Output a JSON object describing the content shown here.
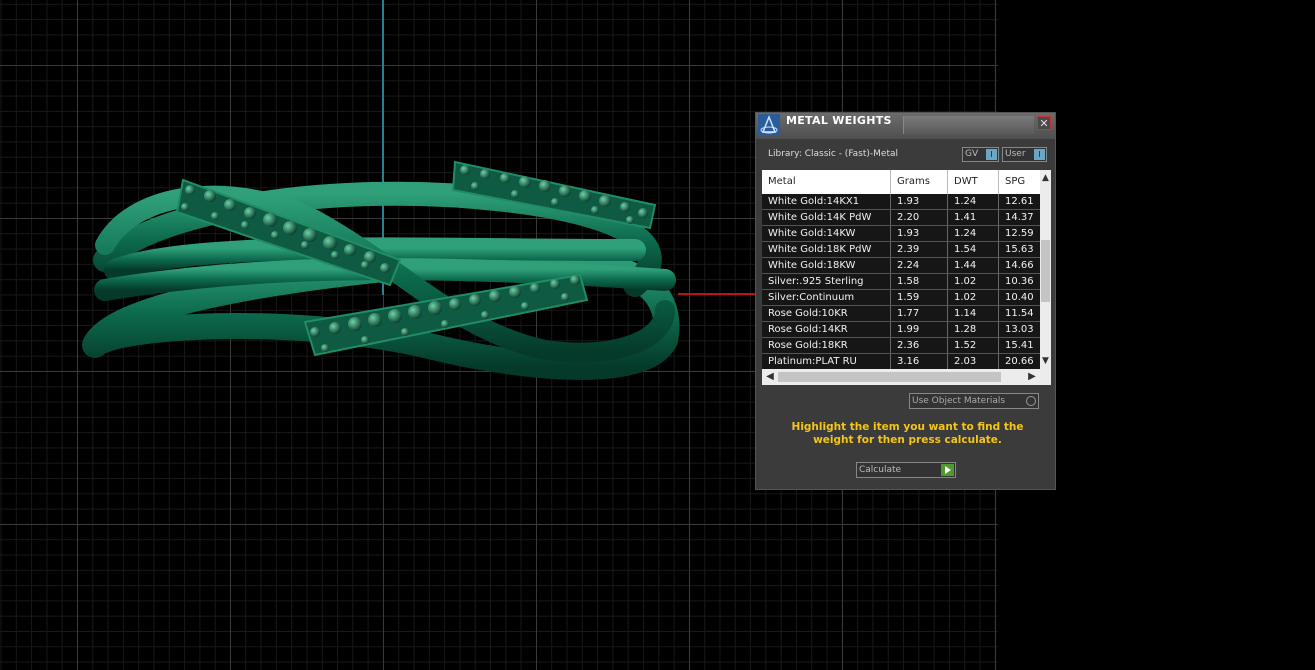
{
  "panel": {
    "title": "METAL WEIGHTS",
    "close_label": "✕",
    "library_label": "Library: Classic - (Fast)-Metal",
    "gv_label": "GV",
    "user_label": "User",
    "columns": [
      "Metal",
      "Grams",
      "DWT",
      "SPG"
    ],
    "rows": [
      [
        "White Gold:14KX1",
        "1.93",
        "1.24",
        "12.61"
      ],
      [
        "White Gold:14K PdW",
        "2.20",
        "1.41",
        "14.37"
      ],
      [
        "White Gold:14KW",
        "1.93",
        "1.24",
        "12.59"
      ],
      [
        "White Gold:18K PdW",
        "2.39",
        "1.54",
        "15.63"
      ],
      [
        "White Gold:18KW",
        "2.24",
        "1.44",
        "14.66"
      ],
      [
        "Silver:.925 Sterling",
        "1.58",
        "1.02",
        "10.36"
      ],
      [
        "Silver:Continuum",
        "1.59",
        "1.02",
        "10.40"
      ],
      [
        "Rose Gold:10KR",
        "1.77",
        "1.14",
        "11.54"
      ],
      [
        "Rose Gold:14KR",
        "1.99",
        "1.28",
        "13.03"
      ],
      [
        "Rose Gold:18KR",
        "2.36",
        "1.52",
        "15.41"
      ],
      [
        "Platinum:PLAT RU",
        "3.16",
        "2.03",
        "20.66"
      ]
    ],
    "use_object_materials_label": "Use Object Materials",
    "instructions": "Highlight the item you want to find the weight for then press calculate.",
    "calculate_label": "Calculate",
    "colors": {
      "accent_text": "#f5c518",
      "play_button": "#4f9a2e"
    }
  },
  "viewport": {
    "model_color": "#0d6b4e",
    "axis_y_color": "#2b7f93",
    "axis_x_color": "#b51515"
  }
}
